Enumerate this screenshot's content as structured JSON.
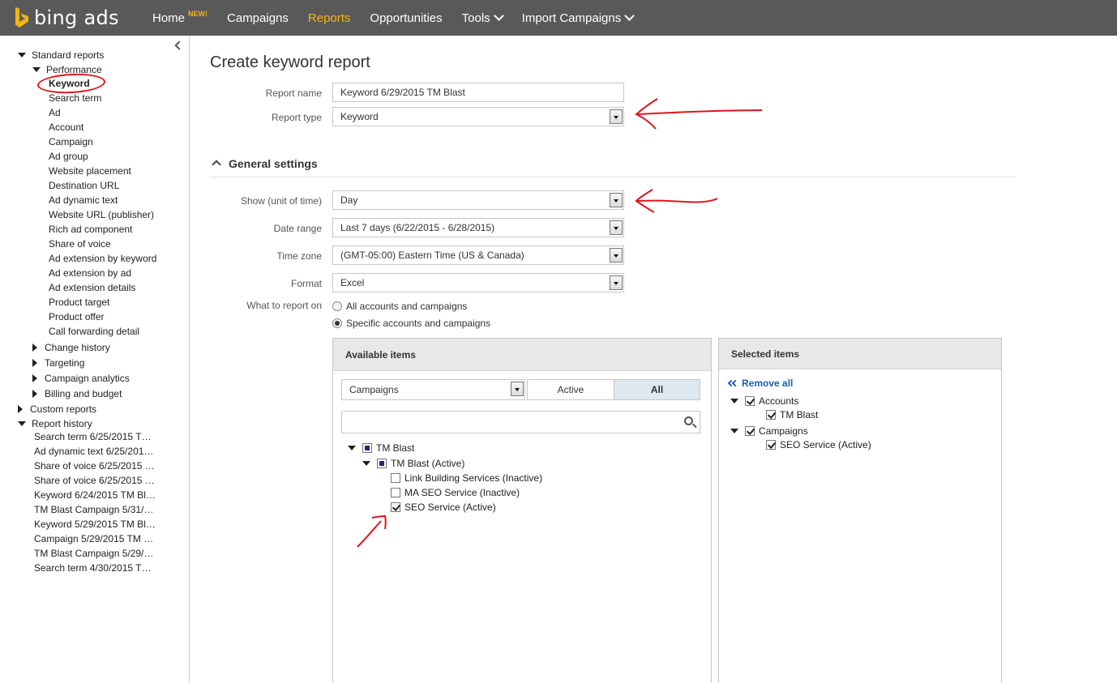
{
  "brand": {
    "name": "bing ads",
    "accent": "#f2b511"
  },
  "nav": {
    "home": "Home",
    "home_badge": "NEW!",
    "campaigns": "Campaigns",
    "reports": "Reports",
    "opportunities": "Opportunities",
    "tools": "Tools",
    "import": "Import Campaigns"
  },
  "sidebar": {
    "standard_reports": "Standard reports",
    "performance": "Performance",
    "performance_items": [
      "Keyword",
      "Search term",
      "Ad",
      "Account",
      "Campaign",
      "Ad group",
      "Website placement",
      "Destination URL",
      "Ad dynamic text",
      "Website URL (publisher)",
      "Rich ad component",
      "Share of voice",
      "Ad extension by keyword",
      "Ad extension by ad",
      "Ad extension details",
      "Product target",
      "Product offer",
      "Call forwarding detail"
    ],
    "change_history": "Change history",
    "targeting": "Targeting",
    "campaign_analytics": "Campaign analytics",
    "billing_budget": "Billing and budget",
    "custom_reports": "Custom reports",
    "report_history": "Report history",
    "history_items": [
      "Search term 6/25/2015 T…",
      "Ad dynamic text 6/25/201…",
      "Share of voice 6/25/2015 …",
      "Share of voice 6/25/2015 …",
      "Keyword 6/24/2015 TM Bl…",
      "TM Blast Campaign 5/31/…",
      "Keyword 5/29/2015 TM Bl…",
      "Campaign 5/29/2015 TM …",
      "TM Blast Campaign 5/29/…",
      "Search term 4/30/2015 T…"
    ]
  },
  "main": {
    "title": "Create keyword report",
    "report_name_label": "Report name",
    "report_name_value": "Keyword 6/29/2015 TM Blast",
    "report_type_label": "Report type",
    "report_type_value": "Keyword",
    "general_settings": "General settings",
    "unit_label": "Show (unit of time)",
    "unit_value": "Day",
    "date_range_label": "Date range",
    "date_range_value": "Last 7 days (6/22/2015 - 6/28/2015)",
    "time_zone_label": "Time zone",
    "time_zone_value": "(GMT-05:00) Eastern Time (US & Canada)",
    "format_label": "Format",
    "format_value": "Excel",
    "what_label": "What to report on",
    "radio_all": "All accounts and campaigns",
    "radio_specific": "Specific accounts and campaigns"
  },
  "available": {
    "header": "Available items",
    "filter_value": "Campaigns",
    "toggle_active": "Active",
    "toggle_all": "All",
    "search_placeholder": "",
    "tree": {
      "account": "TM Blast",
      "campaign": "TM Blast (Active)",
      "groups": [
        "Link Building Services (Inactive)",
        "MA SEO Service (Inactive)",
        "SEO Service (Active)"
      ]
    }
  },
  "selected": {
    "header": "Selected items",
    "remove_all": "Remove all",
    "accounts_label": "Accounts",
    "account_item": "TM Blast",
    "campaigns_label": "Campaigns",
    "campaign_item": "SEO Service (Active)"
  }
}
